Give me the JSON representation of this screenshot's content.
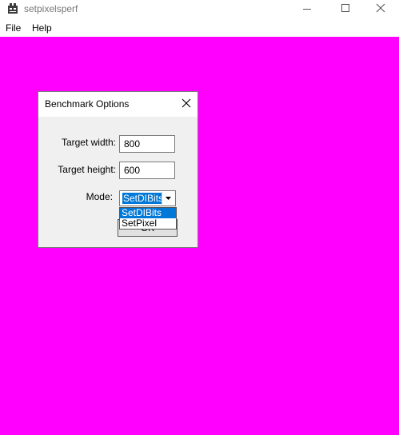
{
  "window": {
    "title": "setpixelsperf",
    "icon": "app-icon"
  },
  "menubar": {
    "items": [
      {
        "label": "File"
      },
      {
        "label": "Help"
      }
    ]
  },
  "canvas": {
    "background_color": "#ff00ff"
  },
  "dialog": {
    "title": "Benchmark Options",
    "target_width_label": "Target width:",
    "target_width_value": "800",
    "target_height_label": "Target height:",
    "target_height_value": "600",
    "mode_label": "Mode:",
    "mode_selected": "SetDIBits",
    "mode_options": [
      "SetDIBits",
      "SetPixel"
    ],
    "ok_label": "OK"
  },
  "colors": {
    "selection": "#0078d7",
    "dialog_bg": "#f0f0f0"
  }
}
